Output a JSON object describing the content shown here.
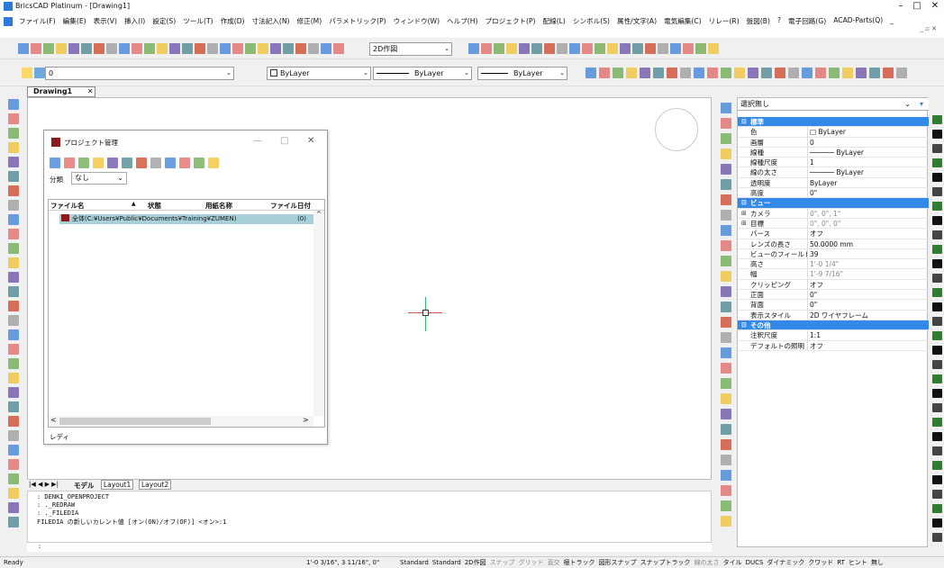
{
  "title": "BricsCAD Platinum - [Drawing1]",
  "window_controls": [
    "–",
    "□",
    "✕"
  ],
  "menu": [
    "ファイル(F)",
    "編集(E)",
    "表示(V)",
    "挿入(I)",
    "設定(S)",
    "ツール(T)",
    "作成(D)",
    "寸法記入(N)",
    "修正(M)",
    "パラメトリック(P)",
    "ウィンドウ(W)",
    "ヘルプ(H)",
    "プロジェクト(P)",
    "配線(L)",
    "シンボル(S)",
    "属性/文字(A)",
    "電気編集(C)",
    "リレー(R)",
    "盤図(B)",
    "?",
    "電子回路(G)",
    "ACAD-Parts(Q)",
    "_"
  ],
  "menu_sub": "_ ▫ ✕",
  "toolbar": {
    "workspace": "2D作図",
    "layer": "0",
    "color": "ByLayer",
    "linetype": "ByLayer",
    "lineweight": "ByLayer"
  },
  "doc_tab": "Drawing1",
  "doc_tab_close": "✕",
  "dialog": {
    "title": "プロジェクト管理",
    "classify_label": "分類",
    "classify_value": "なし",
    "columns": [
      "ファイル名",
      "▲",
      "状態",
      "用紙名称",
      "ファイル日付"
    ],
    "rows": [
      {
        "name": "全体(C:¥Users¥Public¥Documents¥Training¥ZUMEN)",
        "value": "(0)"
      }
    ],
    "status": "レディ"
  },
  "layout_tabs": [
    "モデル",
    "Layout1",
    "Layout2"
  ],
  "command_history": [
    ": DENKI_OPENPROJECT",
    ": ._REDRAW",
    ": ._FILEDIA",
    "FILEDIA の新しいカレント値 [オン(ON)/オフ(OF)] <オン>:1"
  ],
  "command_prompt": ":",
  "properties": {
    "selection": "選択無し",
    "rows": [
      {
        "type": "cat",
        "k": "標準"
      },
      {
        "k": "色",
        "v": "□ ByLayer"
      },
      {
        "k": "画層",
        "v": "0"
      },
      {
        "k": "線種",
        "v": "──────  ByLayer"
      },
      {
        "k": "線種尺度",
        "v": "1"
      },
      {
        "k": "線の太さ",
        "v": "──────  ByLayer"
      },
      {
        "k": "透明度",
        "v": "ByLayer"
      },
      {
        "k": "高度",
        "v": "0\""
      },
      {
        "type": "cat",
        "k": "ビュー"
      },
      {
        "k": "カメラ",
        "v": "0\", 0\", 1\"",
        "dim": true,
        "exp": true
      },
      {
        "k": "目標",
        "v": "0\", 0\", 0\"",
        "dim": true,
        "exp": true
      },
      {
        "k": "パース",
        "v": "オフ"
      },
      {
        "k": "レンズの長さ",
        "v": "50.0000 mm"
      },
      {
        "k": "ビューのフィールド",
        "v": "39"
      },
      {
        "k": "高さ",
        "v": "1'-0 1/4\"",
        "dim": true
      },
      {
        "k": "幅",
        "v": "1'-9 7/16\"",
        "dim": true
      },
      {
        "k": "クリッピング",
        "v": "オフ"
      },
      {
        "k": "正面",
        "v": "0\""
      },
      {
        "k": "背面",
        "v": "0\""
      },
      {
        "k": "表示スタイル",
        "v": "2D ワイヤフレーム"
      },
      {
        "type": "cat",
        "k": "その他"
      },
      {
        "k": "注釈尺度",
        "v": "1:1"
      },
      {
        "k": "デフォルトの照明",
        "v": "オフ"
      }
    ]
  },
  "status": {
    "ready": "Ready",
    "coords": "1'-0 3/16\", 3 11/16\", 0\"",
    "items": [
      "Standard",
      "Standard",
      "2D作図",
      "スナップ",
      "グリッド",
      "直交",
      "極トラック",
      "図形スナップ",
      "スナップトラック",
      "線の太さ",
      "タイル",
      "DUCS",
      "ダイナミック",
      "クワッド",
      "RT",
      "ヒント",
      "無し"
    ]
  }
}
